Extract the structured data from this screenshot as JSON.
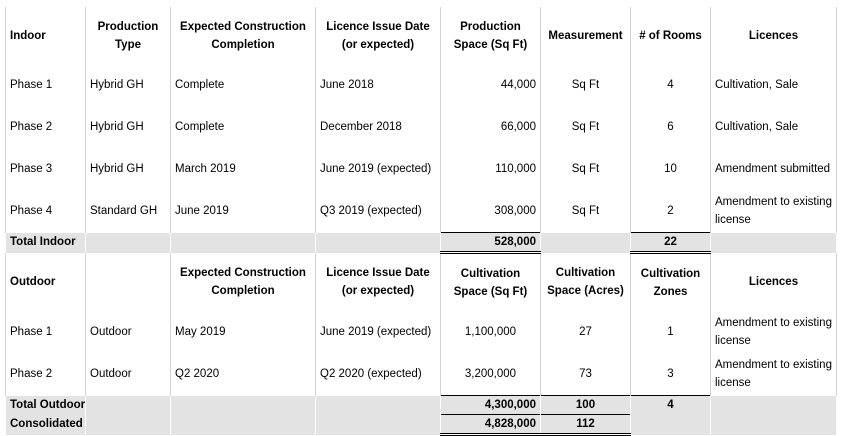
{
  "indoor": {
    "headers": [
      "Indoor",
      "Production Type",
      "Expected Construction Completion",
      "Licence Issue Date (or expected)",
      "Production Space (Sq Ft)",
      "Measurement",
      "# of Rooms",
      "Licences"
    ],
    "rows": [
      [
        "Phase 1",
        "Hybrid GH",
        "Complete",
        "June  2018",
        "44,000",
        "Sq Ft",
        "4",
        "Cultivation, Sale"
      ],
      [
        "Phase 2",
        "Hybrid GH",
        "Complete",
        "December 2018",
        "66,000",
        "Sq Ft",
        "6",
        "Cultivation, Sale"
      ],
      [
        "Phase 3",
        "Hybrid GH",
        "March 2019",
        "June 2019 (expected)",
        "110,000",
        "Sq Ft",
        "10",
        "Amendment submitted"
      ],
      [
        "Phase 4",
        "Standard GH",
        "June 2019",
        "Q3 2019 (expected)",
        "308,000",
        "Sq Ft",
        "2",
        "Amendment to existing license"
      ]
    ],
    "total": {
      "label": "Total Indoor",
      "space": "528,000",
      "rooms": "22"
    }
  },
  "outdoor": {
    "headers": [
      "Outdoor",
      "",
      "Expected Construction Completion",
      "Licence Issue Date (or expected)",
      "Cultivation Space (Sq Ft)",
      "Cultivation Space (Acres)",
      "Cultivation Zones",
      "Licences"
    ],
    "rows": [
      [
        "Phase 1",
        "Outdoor",
        "May 2019",
        "June 2019 (expected)",
        "1,100,000",
        "27",
        "1",
        "Amendment to existing license"
      ],
      [
        "Phase 2",
        "Outdoor",
        "Q2 2020",
        "Q2 2020 (expected)",
        "3,200,000",
        "73",
        "3",
        "Amendment to existing license"
      ]
    ],
    "total": {
      "label": "Total Outdoor",
      "space": "4,300,000",
      "acres": "100",
      "zones": "4"
    }
  },
  "consolidated": {
    "label": "Consolidated",
    "space": "4,828,000",
    "acres": "112"
  }
}
